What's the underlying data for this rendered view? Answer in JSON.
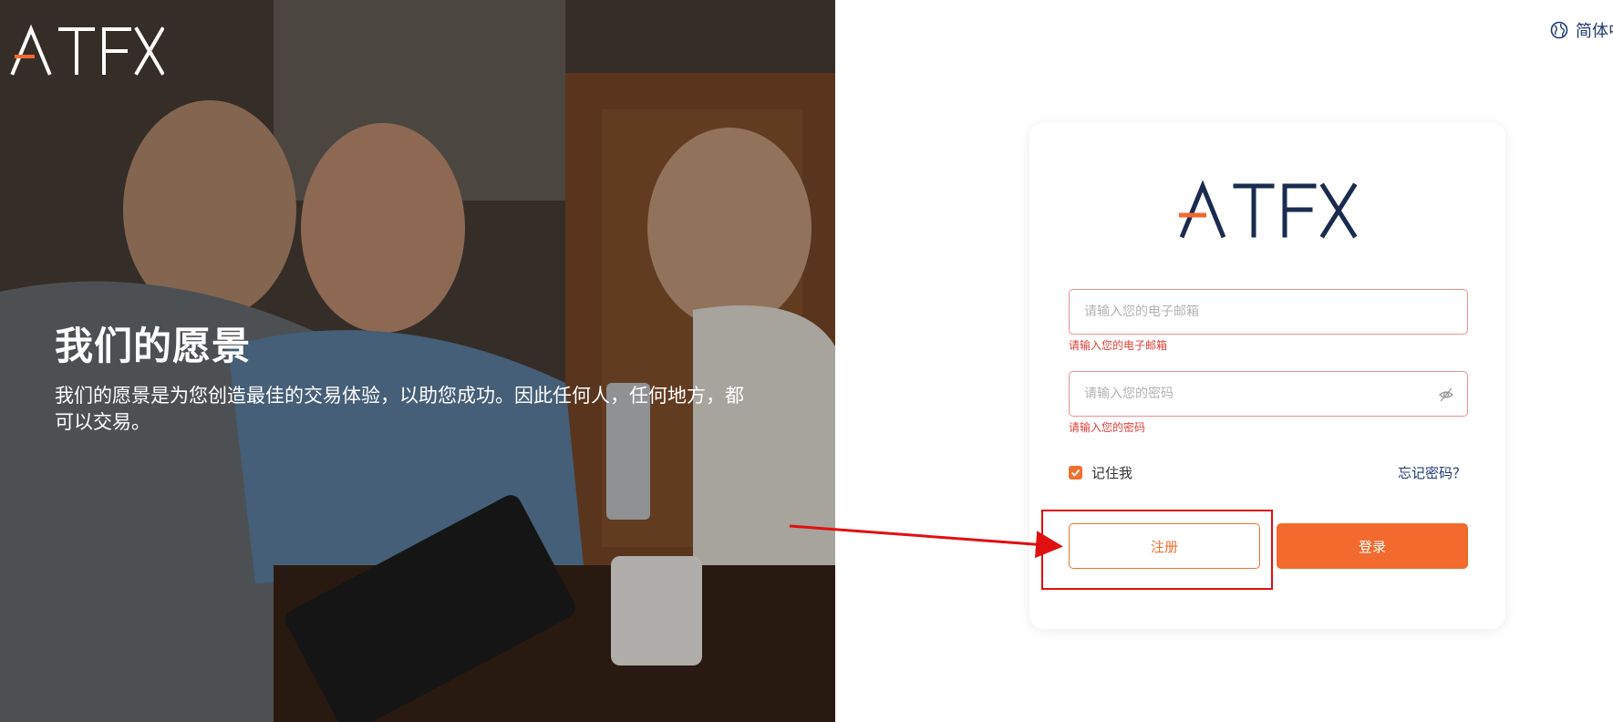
{
  "hero": {
    "brand": "ATFX",
    "title": "我们的愿景",
    "description": "我们的愿景是为您创造最佳的交易体验，以助您成功。因此任何人，任何地方，都可以交易。"
  },
  "language": {
    "label": "简体中文",
    "icon": "globe-icon"
  },
  "login": {
    "brand": "ATFX",
    "email": {
      "placeholder": "请输入您的电子邮箱",
      "value": "",
      "error": "请输入您的电子邮箱"
    },
    "password": {
      "placeholder": "请输入您的密码",
      "value": "",
      "error": "请输入您的密码",
      "icon": "eye-off-icon"
    },
    "remember_label": "记住我",
    "remember_checked": true,
    "forgot_label": "忘记密码？",
    "register_label": "注册",
    "login_label": "登录"
  },
  "colors": {
    "accent": "#f26a2e",
    "navy": "#1f3b73",
    "error": "#e0413a",
    "annotation": "#e01010"
  }
}
